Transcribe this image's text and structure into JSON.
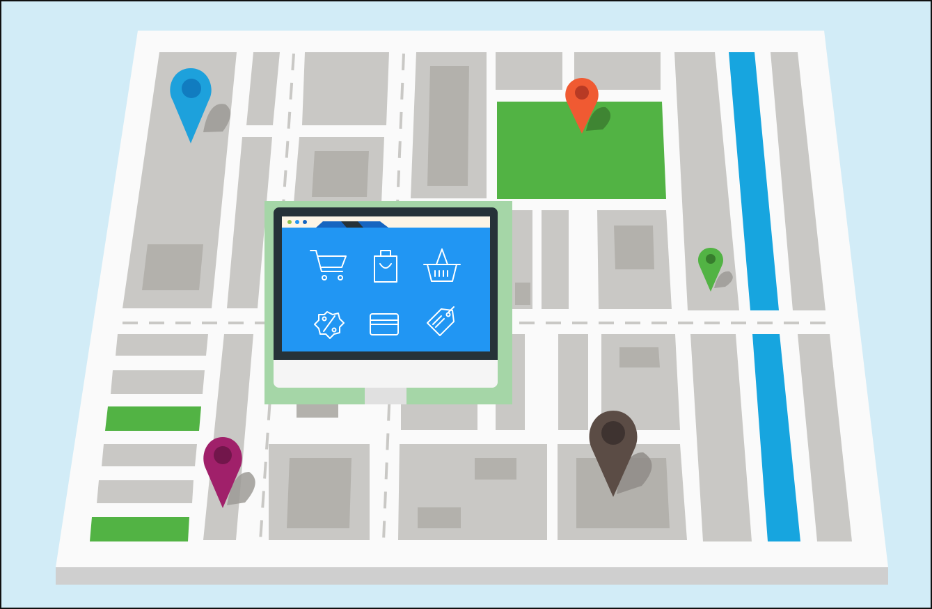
{
  "scene": {
    "subject": "isometric-city-map-with-online-shop-monitor",
    "colors": {
      "background": "#d2ecf7",
      "map_surface": "#fafafa",
      "map_edge": "#cfcfcf",
      "block": "#c9c8c5",
      "building": "#b3b1ac",
      "park": "#52b344",
      "river": "#17a5df",
      "monitor_frame": "#263238",
      "monitor_screen": "#2196f3",
      "monitor_stand_plate": "#a5d6a7"
    }
  },
  "pins": [
    {
      "name": "pin-blue",
      "color": "#1da1dc"
    },
    {
      "name": "pin-orange",
      "color": "#f05a32"
    },
    {
      "name": "pin-green",
      "color": "#52b344"
    },
    {
      "name": "pin-purple",
      "color": "#a0206a"
    },
    {
      "name": "pin-brown",
      "color": "#5b4c45"
    }
  ],
  "monitor": {
    "browser_dots": [
      "#8bc34a",
      "#2196f3",
      "#1565c0"
    ],
    "icons": [
      "shopping-cart-icon",
      "shopping-bag-icon",
      "basket-icon",
      "discount-badge-icon",
      "credit-card-icon",
      "price-tag-icon"
    ]
  }
}
